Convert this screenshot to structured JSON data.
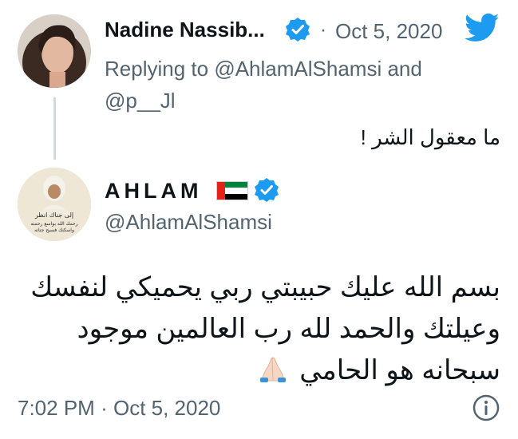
{
  "reply_tweet": {
    "author_name": "Nadine Nassib...",
    "separator": "·",
    "date": "Oct 5, 2020",
    "replying_prefix": "Replying to",
    "replying_user1": "@AhlamAlShamsi",
    "replying_and": "and",
    "replying_user2": "@p__Jl",
    "text": "ما معقول الشر !"
  },
  "main_tweet": {
    "author_name": "AHLAM",
    "handle": "@AhlamAlShamsi",
    "avatar_caption_line1": "إلى جناك انظر",
    "avatar_caption_line2": "رحمك الله بواسع رحمته",
    "avatar_caption_line3": "واسكنك فسيح جناته",
    "text_line1": "بسم الله عليك حبيبتي ربي يحميكي لنفسك",
    "text_line2": "وعيلتك والحمد لله رب العالمين موجود",
    "text_line3": "سبحانه هو الحامي",
    "emoji": "folded-hands-emoji",
    "time": "7:02 PM",
    "separator": "·",
    "date": "Oct 5, 2020"
  },
  "icons": {
    "verified": "verified-badge-icon",
    "twitter": "twitter-bird-icon",
    "flag": "uae-flag-icon",
    "info": "info-icon"
  },
  "colors": {
    "twitter_blue": "#1d9bf0",
    "secondary_text": "#536471",
    "thread_line": "#cfd9de"
  }
}
